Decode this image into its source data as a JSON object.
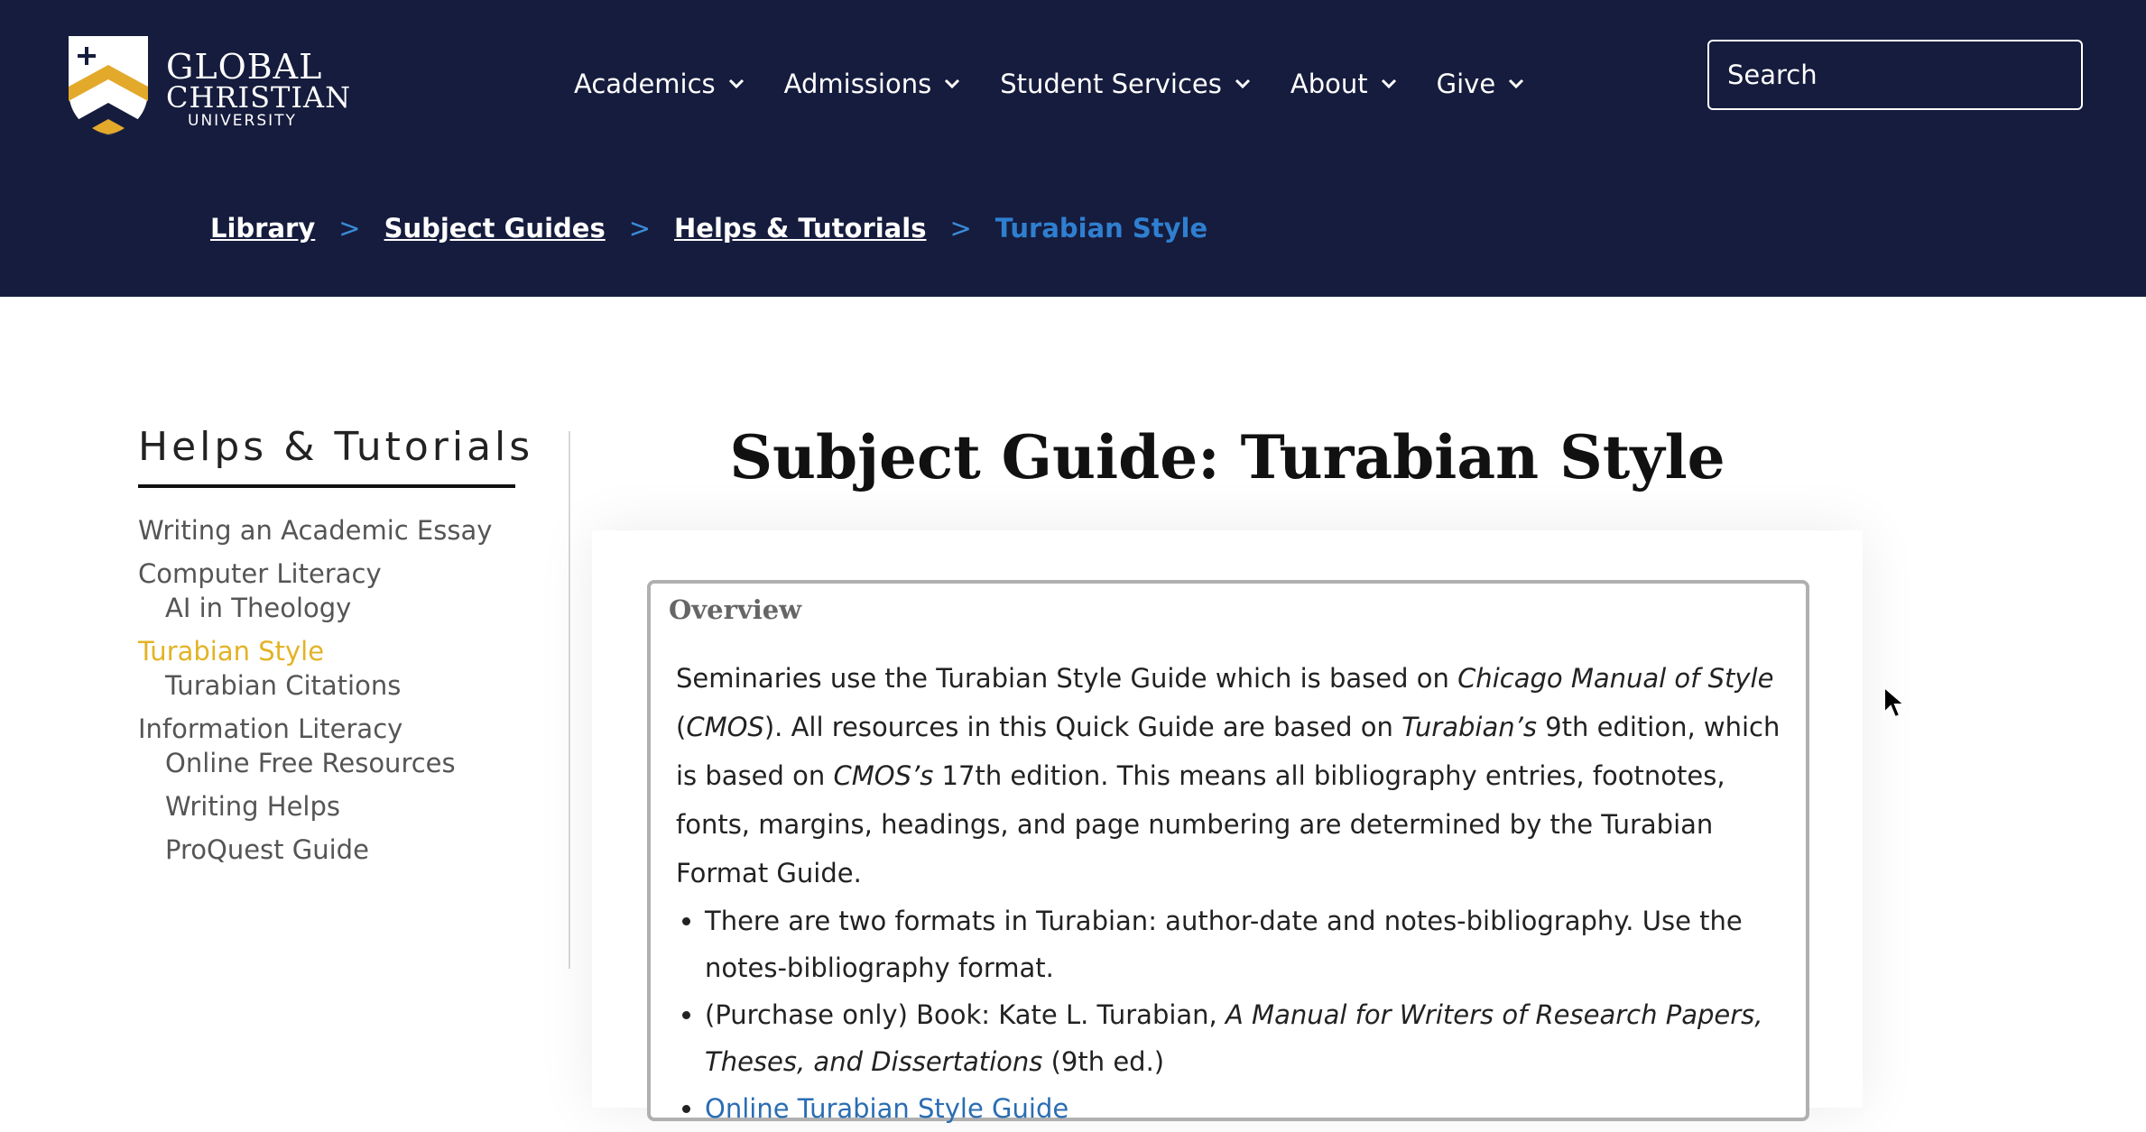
{
  "header": {
    "logo": {
      "line1": "GLOBAL",
      "line2": "CHRISTIAN",
      "line3": "UNIVERSITY"
    },
    "nav": [
      {
        "label": "Academics"
      },
      {
        "label": "Admissions"
      },
      {
        "label": "Student Services"
      },
      {
        "label": "About"
      },
      {
        "label": "Give"
      }
    ],
    "search": {
      "placeholder": "Search"
    }
  },
  "breadcrumb": {
    "items": [
      "Library",
      "Subject Guides",
      "Helps & Tutorials"
    ],
    "separator": ">",
    "current": "Turabian Style"
  },
  "sidebar": {
    "title": "Helps & Tutorials",
    "items": [
      {
        "label": "Writing an Academic Essay"
      },
      {
        "label": "Computer Literacy"
      },
      {
        "label": "AI in Theology"
      },
      {
        "label": "Turabian Style"
      },
      {
        "label": "Turabian Citations"
      },
      {
        "label": "Information Literacy"
      },
      {
        "label": "Online Free Resources"
      },
      {
        "label": "Writing Helps"
      },
      {
        "label": "ProQuest Guide"
      }
    ]
  },
  "main": {
    "title": "Subject Guide: Turabian Style",
    "overview": {
      "title": "Overview",
      "intro": {
        "a": "Seminaries use the Turabian Style Guide which is based on ",
        "b": "Chicago Manual of Style",
        "c": " (",
        "d": "CMOS",
        "e": "). All resources in this Quick Guide are based on ",
        "f": "Turabian’s",
        "g": " 9th edition, which is based on ",
        "h": "CMOS’s",
        "i": " 17th edition. This means all bibliography entries, footnotes, fonts, margins, headings, and page numbering are determined by the Turabian Format Guide."
      },
      "bullet1": "There are two formats in Turabian: author-date and notes-bibliography. Use the notes-bibliography format.",
      "bullet2": {
        "a": "(Purchase only) Book: Kate L. Turabian, ",
        "b": "A Manual for Writers of Research Papers, Theses, and Dissertations",
        "c": " (9th ed.)"
      },
      "bullet3": "Online Turabian Style Guide"
    }
  },
  "colors": {
    "header_bg": "#161c3d",
    "accent_gold": "#e3b325",
    "link_blue": "#2a6db3",
    "breadcrumb_current": "#2f7fd0"
  }
}
